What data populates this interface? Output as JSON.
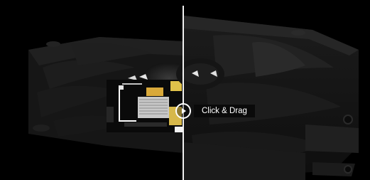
{
  "comparison_slider": {
    "hint_label": "Click & Drag"
  }
}
